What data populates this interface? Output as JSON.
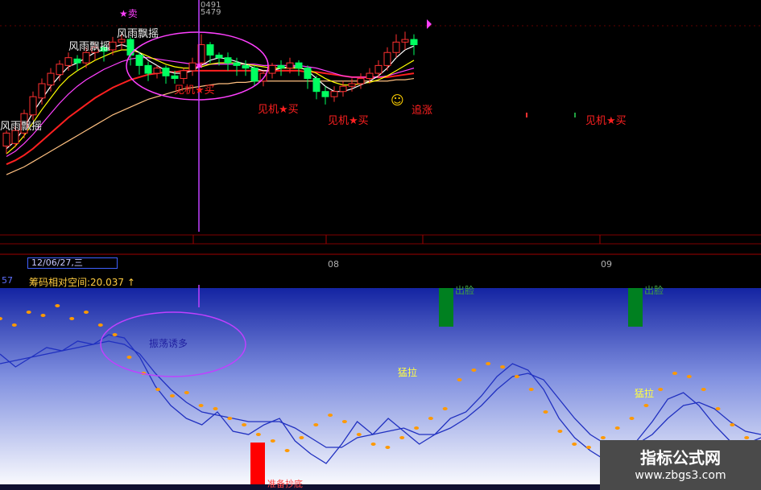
{
  "colors": {
    "up": "#ff3030",
    "down": "#00ff60",
    "ma_short": "#ffffff",
    "ma_mid": "#ffff00",
    "ma_long1": "#ff40ff",
    "ma_long2": "#ff2020",
    "ma_long3": "#ffc080",
    "cursor": "#c040ff",
    "ind_line": "#2030c0",
    "ind_dot": "#ff9900",
    "bar_red": "#ff0000",
    "bar_green": "#008020"
  },
  "top_panel": {
    "cursor_readout": [
      "0491",
      "5479"
    ],
    "star_sell": "★卖",
    "wind_labels": [
      "风雨飘摇",
      "风雨飘摇",
      "风雨飘摇"
    ],
    "buy_signals": [
      "见机★买",
      "见机★买",
      "见机★买",
      "见机★买"
    ],
    "chase_label": "追涨",
    "smiley": "☺"
  },
  "axis": {
    "date": "12/06/27,三",
    "months": [
      "08",
      "09"
    ]
  },
  "indicator": {
    "left_tag": "57",
    "title": "筹码相对空间:20.037 ↑",
    "oscillate_text": "振荡诱多",
    "pull_labels": [
      "猛拉",
      "猛拉"
    ],
    "run_labels": [
      "出脸",
      "出脸"
    ],
    "bottom_label": "准备抄底"
  },
  "watermark": {
    "title": "指标公式网",
    "url": "www.zbgs3.com"
  },
  "chart_data": [
    {
      "type": "candlestick",
      "candles": [
        [
          10,
          20,
          5,
          22,
          4
        ],
        [
          12,
          22,
          10,
          25,
          9
        ],
        [
          20,
          35,
          18,
          38,
          16
        ],
        [
          34,
          48,
          32,
          52,
          30
        ],
        [
          47,
          58,
          44,
          62,
          42
        ],
        [
          57,
          66,
          55,
          70,
          52
        ],
        [
          65,
          73,
          62,
          76,
          60
        ],
        [
          72,
          78,
          70,
          82,
          68
        ],
        [
          77,
          74,
          70,
          80,
          68
        ],
        [
          74,
          82,
          72,
          86,
          70
        ],
        [
          82,
          86,
          78,
          90,
          76
        ],
        [
          86,
          83,
          78,
          88,
          75
        ],
        [
          84,
          90,
          82,
          94,
          80
        ],
        [
          90,
          92,
          86,
          96,
          84
        ],
        [
          92,
          80,
          76,
          94,
          72
        ],
        [
          80,
          72,
          68,
          82,
          65
        ],
        [
          72,
          66,
          62,
          75,
          60
        ],
        [
          66,
          70,
          64,
          72,
          62
        ],
        [
          70,
          64,
          60,
          72,
          58
        ],
        [
          64,
          62,
          60,
          68,
          58
        ],
        [
          62,
          68,
          60,
          70,
          58
        ],
        [
          68,
          74,
          66,
          78,
          64
        ],
        [
          74,
          88,
          72,
          96,
          70
        ],
        [
          88,
          80,
          76,
          90,
          74
        ],
        [
          80,
          78,
          74,
          82,
          72
        ],
        [
          78,
          74,
          70,
          82,
          68
        ],
        [
          74,
          72,
          66,
          78,
          64
        ],
        [
          72,
          70,
          66,
          76,
          64
        ],
        [
          70,
          60,
          58,
          72,
          56
        ],
        [
          60,
          66,
          58,
          68,
          56
        ],
        [
          66,
          72,
          64,
          74,
          62
        ],
        [
          72,
          70,
          66,
          76,
          64
        ],
        [
          70,
          74,
          68,
          78,
          66
        ],
        [
          74,
          70,
          66,
          76,
          64
        ],
        [
          70,
          62,
          56,
          72,
          54
        ],
        [
          62,
          52,
          48,
          64,
          46
        ],
        [
          52,
          48,
          44,
          56,
          42
        ],
        [
          48,
          52,
          46,
          56,
          44
        ],
        [
          52,
          56,
          50,
          60,
          48
        ],
        [
          56,
          58,
          54,
          62,
          52
        ],
        [
          58,
          62,
          56,
          66,
          54
        ],
        [
          62,
          66,
          60,
          70,
          58
        ],
        [
          66,
          72,
          64,
          76,
          62
        ],
        [
          72,
          82,
          70,
          86,
          68
        ],
        [
          82,
          90,
          80,
          96,
          78
        ],
        [
          90,
          92,
          86,
          98,
          84
        ],
        [
          92,
          88,
          84,
          96,
          80
        ]
      ],
      "candle_format": [
        "open",
        "close",
        "low_body",
        "high",
        "low"
      ],
      "ma_short": [
        8,
        14,
        24,
        36,
        46,
        56,
        64,
        71,
        74,
        78,
        82,
        84,
        86,
        88,
        86,
        82,
        76,
        72,
        68,
        66,
        66,
        68,
        72,
        76,
        78,
        77,
        75,
        73,
        70,
        68,
        68,
        70,
        71,
        71,
        68,
        62,
        56,
        52,
        52,
        54,
        57,
        60,
        64,
        70,
        78,
        84,
        87
      ],
      "ma_mid": [
        4,
        10,
        18,
        28,
        38,
        47,
        56,
        63,
        68,
        72,
        76,
        79,
        82,
        84,
        84,
        82,
        79,
        76,
        73,
        71,
        70,
        70,
        71,
        73,
        74,
        74,
        74,
        73,
        72,
        71,
        70,
        70,
        70,
        70,
        69,
        66,
        62,
        59,
        57,
        57,
        58,
        59,
        61,
        64,
        68,
        72,
        76
      ],
      "ma_long1": [
        2,
        6,
        12,
        19,
        27,
        35,
        43,
        50,
        56,
        61,
        65,
        69,
        72,
        75,
        77,
        78,
        78,
        77,
        76,
        75,
        74,
        73,
        73,
        73,
        73,
        73,
        73,
        73,
        73,
        72,
        72,
        72,
        72,
        72,
        71,
        70,
        68,
        66,
        64,
        63,
        63,
        63,
        63,
        64,
        66,
        68,
        70
      ],
      "ma_long2": [
        -4,
        -1,
        3,
        8,
        14,
        20,
        26,
        32,
        37,
        42,
        47,
        51,
        55,
        58,
        61,
        63,
        65,
        66,
        67,
        67,
        68,
        68,
        68,
        68,
        68,
        68,
        68,
        68,
        68,
        68,
        68,
        68,
        68,
        68,
        67,
        67,
        66,
        65,
        64,
        63,
        63,
        63,
        63,
        63,
        64,
        65,
        66
      ],
      "ma_long3": [
        -12,
        -9,
        -6,
        -2,
        2,
        6,
        10,
        14,
        18,
        22,
        26,
        30,
        34,
        37,
        40,
        43,
        46,
        48,
        50,
        52,
        54,
        55,
        56,
        57,
        58,
        58,
        59,
        59,
        60,
        60,
        60,
        60,
        60,
        60,
        60,
        60,
        60,
        60,
        60,
        60,
        60,
        60,
        60,
        60,
        61,
        61,
        62
      ],
      "y_range": [
        -20,
        110
      ]
    },
    {
      "type": "line",
      "series": [
        {
          "values": [
            62,
            54,
            60,
            66,
            64,
            70,
            68,
            74,
            72,
            60,
            42,
            30,
            22,
            18,
            26,
            14,
            12,
            18,
            22,
            8,
            0,
            -6,
            6,
            20,
            12,
            22,
            14,
            6,
            12,
            22,
            26,
            36,
            48,
            56,
            52,
            40,
            22,
            10,
            2,
            -4,
            -2,
            8,
            20,
            34,
            38,
            30,
            18,
            8,
            6,
            10
          ]
        },
        {
          "values": [
            56,
            58,
            60,
            62,
            64,
            66,
            68,
            70,
            68,
            62,
            50,
            40,
            32,
            26,
            24,
            22,
            20,
            20,
            20,
            16,
            10,
            4,
            4,
            10,
            12,
            14,
            16,
            12,
            12,
            16,
            22,
            30,
            40,
            48,
            50,
            46,
            34,
            22,
            12,
            6,
            4,
            6,
            12,
            22,
            30,
            32,
            28,
            20,
            14,
            12
          ]
        }
      ],
      "dots": [
        84,
        80,
        88,
        86,
        92,
        84,
        88,
        80,
        74,
        60,
        50,
        40,
        36,
        38,
        30,
        28,
        22,
        18,
        12,
        8,
        2,
        10,
        18,
        24,
        20,
        12,
        6,
        4,
        10,
        16,
        22,
        28,
        46,
        52,
        56,
        54,
        48,
        40,
        26,
        14,
        6,
        4,
        10,
        16,
        22,
        30,
        40,
        50,
        48,
        40,
        28,
        18,
        10,
        6
      ],
      "y_range": [
        -20,
        100
      ]
    }
  ]
}
